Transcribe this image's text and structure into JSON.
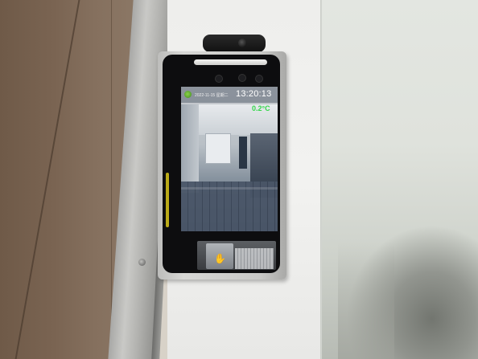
{
  "device": {
    "status_date": "2022-11-15 星期二",
    "status_time": "13:20:13",
    "temperature": "0.2°C",
    "logo_icon": "leaf-logo-icon",
    "hand_icon": "hand-icon"
  },
  "colors": {
    "reading": "#33d64a",
    "bezel": "#0d0d0f",
    "accent": "#d9c71a"
  }
}
